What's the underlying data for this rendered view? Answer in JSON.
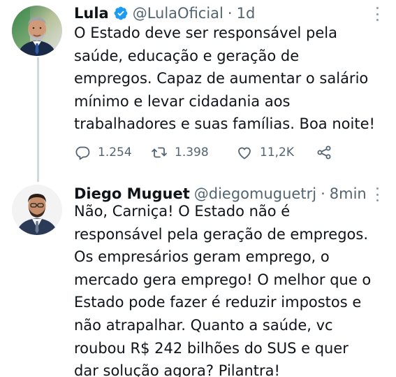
{
  "tweets": [
    {
      "display_name": "Lula",
      "verified": true,
      "handle": "@LulaOficial",
      "separator": "·",
      "time": "1d",
      "text": "O Estado deve ser responsável pela\nsaúde, educação e geração de\nempregos. Capaz de aumentar o salário\nmínimo e levar cidadania aos\ntrabalhadores e suas famílias. Boa noite!",
      "actions": {
        "replies": "1.254",
        "retweets": "1.398",
        "likes": "11,2K"
      }
    },
    {
      "display_name": "Diego Muguet",
      "verified": false,
      "handle": "@diegomuguetrj",
      "separator": "·",
      "time": "8min",
      "text": "Não, Carniça! O Estado não é\nresponsável pela geração de empregos.\nOs empresários geram emprego, o\nmercado gera emprego! O melhor que o\nEstado pode fazer é reduzir impostos e\nnão atrapalhar. Quanto a saúde, vc\nroubou R$ 242 bilhões do SUS e quer\ndar solução agora? Pilantra!"
    }
  ],
  "icons": {
    "verified": "verified-badge-icon",
    "reply": "reply-icon",
    "retweet": "retweet-icon",
    "like": "heart-icon",
    "share": "share-icon",
    "more": "more-vertical-icon"
  },
  "colors": {
    "text_primary": "#0f1419",
    "text_secondary": "#536471",
    "verified_blue": "#1d9bf0",
    "thread_line": "#cfd9de"
  }
}
